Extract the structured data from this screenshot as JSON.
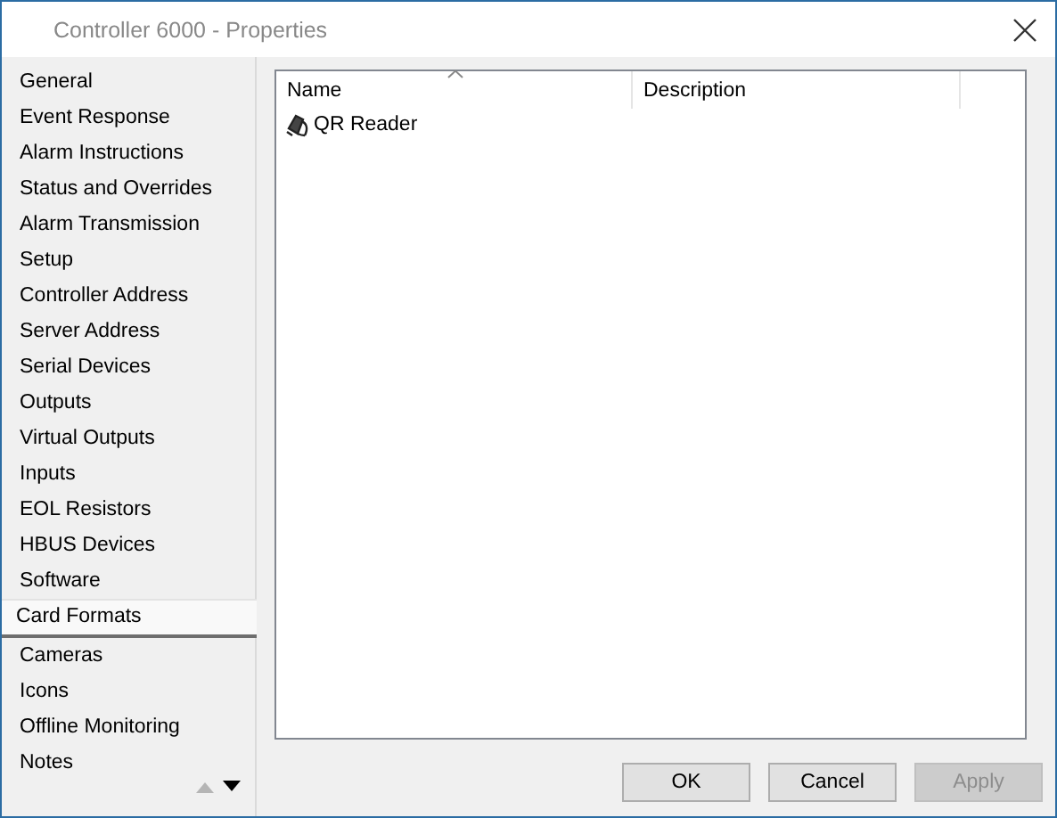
{
  "window": {
    "title": "Controller 6000 - Properties"
  },
  "sidebar": {
    "items": [
      {
        "label": "General",
        "selected": false
      },
      {
        "label": "Event Response",
        "selected": false
      },
      {
        "label": "Alarm Instructions",
        "selected": false
      },
      {
        "label": "Status and Overrides",
        "selected": false
      },
      {
        "label": "Alarm Transmission",
        "selected": false
      },
      {
        "label": "Setup",
        "selected": false
      },
      {
        "label": "Controller Address",
        "selected": false
      },
      {
        "label": "Server Address",
        "selected": false
      },
      {
        "label": "Serial Devices",
        "selected": false
      },
      {
        "label": "Outputs",
        "selected": false
      },
      {
        "label": "Virtual Outputs",
        "selected": false
      },
      {
        "label": "Inputs",
        "selected": false
      },
      {
        "label": "EOL Resistors",
        "selected": false
      },
      {
        "label": "HBUS Devices",
        "selected": false
      },
      {
        "label": "Software",
        "selected": false
      },
      {
        "label": "Card Formats",
        "selected": true
      },
      {
        "label": "Cameras",
        "selected": false
      },
      {
        "label": "Icons",
        "selected": false
      },
      {
        "label": "Offline Monitoring",
        "selected": false
      },
      {
        "label": "Notes",
        "selected": false
      }
    ],
    "scroll_up": {
      "disabled": true
    },
    "scroll_down": {
      "disabled": false
    }
  },
  "table": {
    "columns": [
      {
        "label": "Name",
        "sorted": true
      },
      {
        "label": "Description",
        "sorted": false
      }
    ],
    "rows": [
      {
        "name": "QR Reader"
      }
    ]
  },
  "buttons": [
    {
      "label": "OK",
      "disabled": false
    },
    {
      "label": "Cancel",
      "disabled": false
    },
    {
      "label": "Apply",
      "disabled": true
    }
  ]
}
